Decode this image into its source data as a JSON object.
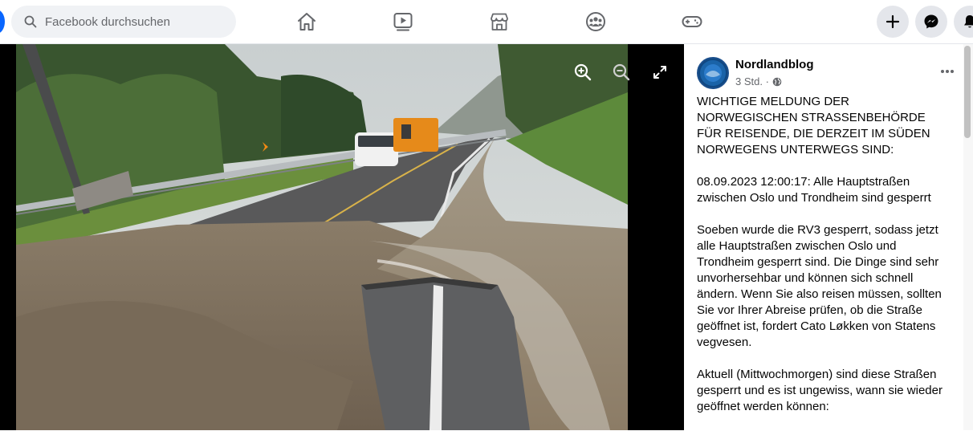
{
  "search": {
    "placeholder": "Facebook durchsuchen"
  },
  "nav": [
    "home-icon",
    "video-icon",
    "marketplace-icon",
    "groups-icon",
    "gaming-icon"
  ],
  "header_actions": [
    "plus-icon",
    "messenger-icon",
    "notifications-icon"
  ],
  "viewer": {
    "tools": [
      "zoom-in-icon",
      "zoom-out-icon",
      "fullscreen-icon"
    ]
  },
  "post": {
    "author": "Nordlandblog",
    "time": "3 Std. ·",
    "paragraphs": [
      "WICHTIGE MELDUNG DER NORWEGISCHEN STRASSENBEHÖRDE FÜR REISENDE, DIE DERZEIT IM SÜDEN NORWEGENS UNTERWEGS SIND:",
      "08.09.2023 12:00:17: Alle Hauptstraßen zwischen Oslo und Trondheim sind gesperrt",
      "Soeben wurde die RV3 gesperrt, sodass jetzt alle Hauptstraßen zwischen Oslo und Trondheim gesperrt sind. Die Dinge sind sehr unvorhersehbar und können sich schnell ändern. Wenn Sie also reisen müssen, sollten Sie vor Ihrer Abreise prüfen, ob die Straße geöffnet ist, fordert Cato Løkken von Statens vegvesen.",
      "Aktuell (Mittwochmorgen) sind diese Straßen gesperrt und es ist ungewiss, wann sie wieder geöffnet werden können:"
    ]
  },
  "colors": {
    "accent": "#0866ff",
    "secondary_text": "#65676b",
    "surface": "#e4e6eb"
  }
}
